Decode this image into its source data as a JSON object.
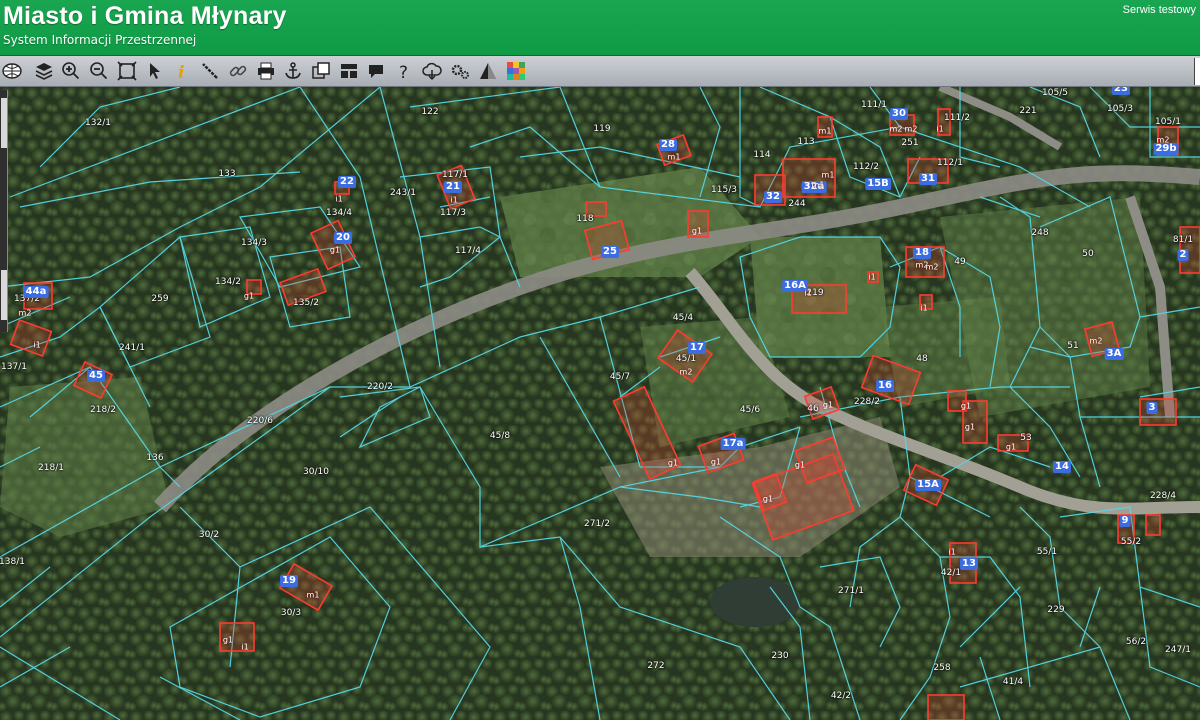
{
  "header": {
    "title": "Miasto i Gmina Młynary",
    "subtitle": "System Informacji Przestrzennej",
    "service": "Serwis testowy"
  },
  "toolbar": {
    "tools": [
      "globe-icon",
      "layers-icon",
      "zoom-in-icon",
      "zoom-out-icon",
      "zoom-extent-icon",
      "pointer-icon",
      "info-icon",
      "measure-distance-icon",
      "link-icon",
      "print-icon",
      "anchor-icon",
      "copy-icon",
      "layout-icon",
      "comment-icon",
      "help-icon",
      "cloud-download-icon",
      "settings-icon",
      "warning-icon",
      "color-palette-icon"
    ]
  },
  "colors": {
    "header": "#13a04a",
    "parcel_line": "#55d6e6",
    "building": "#e8332a",
    "address": "#3b6de0"
  },
  "parcels": [
    {
      "t": "132/1"
    },
    {
      "t": "133"
    },
    {
      "t": "122"
    },
    {
      "t": "119"
    },
    {
      "t": "113"
    },
    {
      "t": "114"
    },
    {
      "t": "111/1"
    },
    {
      "t": "111/2"
    },
    {
      "t": "251"
    },
    {
      "t": "221"
    },
    {
      "t": "105/5"
    },
    {
      "t": "105/3"
    },
    {
      "t": "105/1"
    },
    {
      "t": "117/1"
    },
    {
      "t": "117/3"
    },
    {
      "t": "243/1"
    },
    {
      "t": "134/4"
    },
    {
      "t": "134/3"
    },
    {
      "t": "115/3"
    },
    {
      "t": "118"
    },
    {
      "t": "112/2"
    },
    {
      "t": "112/1"
    },
    {
      "t": "244"
    },
    {
      "t": "248"
    },
    {
      "t": "117/4"
    },
    {
      "t": "134/2"
    },
    {
      "t": "135/2"
    },
    {
      "t": "259"
    },
    {
      "t": "137/2"
    },
    {
      "t": "241/1"
    },
    {
      "t": "137/1"
    },
    {
      "t": "219"
    },
    {
      "t": "49"
    },
    {
      "t": "50"
    },
    {
      "t": "81/1"
    },
    {
      "t": "45/4"
    },
    {
      "t": "45/1"
    },
    {
      "t": "51"
    },
    {
      "t": "48"
    },
    {
      "t": "220/2"
    },
    {
      "t": "218/2"
    },
    {
      "t": "45/7"
    },
    {
      "t": "45/6"
    },
    {
      "t": "228/2"
    },
    {
      "t": "46"
    },
    {
      "t": "220/6"
    },
    {
      "t": "45/8"
    },
    {
      "t": "53"
    },
    {
      "t": "218/1"
    },
    {
      "t": "136"
    },
    {
      "t": "30/10"
    },
    {
      "t": "228/4"
    },
    {
      "t": "271/2"
    },
    {
      "t": "30/2"
    },
    {
      "t": "55/2"
    },
    {
      "t": "55/1"
    },
    {
      "t": "138/1"
    },
    {
      "t": "42/1"
    },
    {
      "t": "30/3"
    },
    {
      "t": "271/1"
    },
    {
      "t": "229"
    },
    {
      "t": "56/2"
    },
    {
      "t": "247/1"
    },
    {
      "t": "272"
    },
    {
      "t": "230"
    },
    {
      "t": "258"
    },
    {
      "t": "41/4"
    },
    {
      "t": "42/2"
    }
  ],
  "addresses": [
    {
      "t": "28"
    },
    {
      "t": "30"
    },
    {
      "t": "22"
    },
    {
      "t": "21"
    },
    {
      "t": "32"
    },
    {
      "t": "32a"
    },
    {
      "t": "15B"
    },
    {
      "t": "31"
    },
    {
      "t": "29b"
    },
    {
      "t": "20"
    },
    {
      "t": "25"
    },
    {
      "t": "18"
    },
    {
      "t": "44a"
    },
    {
      "t": "16A"
    },
    {
      "t": "2"
    },
    {
      "t": "17"
    },
    {
      "t": "45"
    },
    {
      "t": "3A"
    },
    {
      "t": "16"
    },
    {
      "t": "3"
    },
    {
      "t": "17a"
    },
    {
      "t": "14"
    },
    {
      "t": "15A"
    },
    {
      "t": "9"
    },
    {
      "t": "13"
    },
    {
      "t": "19"
    },
    {
      "t": "23"
    }
  ],
  "buildings": [
    {
      "t": "m1"
    },
    {
      "t": "m2"
    },
    {
      "t": "m2"
    },
    {
      "t": "i1"
    },
    {
      "t": "m1"
    },
    {
      "t": "m1"
    },
    {
      "t": "m2"
    },
    {
      "t": "m1"
    },
    {
      "t": "i1"
    },
    {
      "t": "i1"
    },
    {
      "t": "m2"
    },
    {
      "t": "i1"
    },
    {
      "t": "m2"
    },
    {
      "t": "g1"
    },
    {
      "t": "g1"
    },
    {
      "t": "m2"
    },
    {
      "t": "i1"
    },
    {
      "t": "g1"
    },
    {
      "t": "m2"
    },
    {
      "t": "i1"
    },
    {
      "t": "g1"
    },
    {
      "t": "g1"
    },
    {
      "t": "g1"
    },
    {
      "t": "g1"
    },
    {
      "t": "g1"
    },
    {
      "t": "g1"
    },
    {
      "t": "m2"
    },
    {
      "t": "i1"
    },
    {
      "t": "m1"
    },
    {
      "t": "g1"
    },
    {
      "t": "g1"
    },
    {
      "t": "i1"
    },
    {
      "t": "g1"
    },
    {
      "t": "i1"
    }
  ]
}
